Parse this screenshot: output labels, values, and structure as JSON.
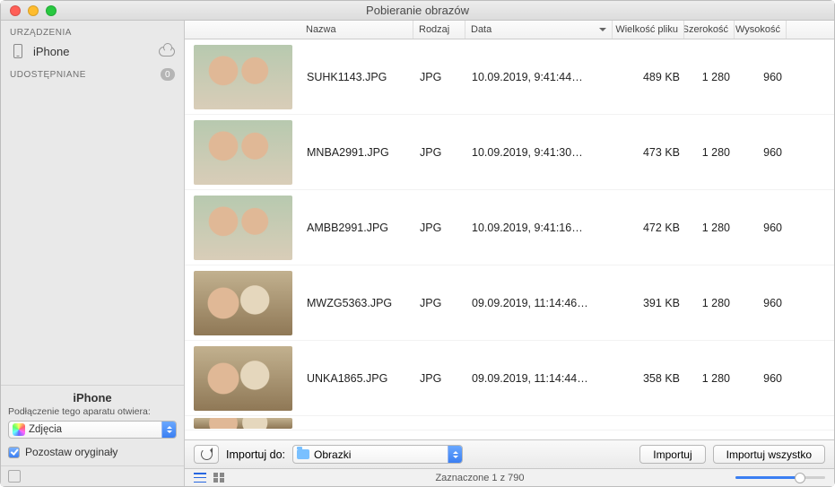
{
  "window": {
    "title": "Pobieranie obrazów"
  },
  "sidebar": {
    "devices_header": "URZĄDZENIA",
    "device_name": "iPhone",
    "shared_header": "UDOSTĘPNIANE",
    "shared_count": "0",
    "bottom_device": "iPhone",
    "bottom_hint": "Podłączenie tego aparatu otwiera:",
    "app_popup": "Zdjęcia",
    "keep_originals": "Pozostaw oryginały"
  },
  "columns": {
    "name": "Nazwa",
    "kind": "Rodzaj",
    "date": "Data",
    "size": "Wielkość pliku",
    "width": "Szerokość",
    "height": "Wysokość"
  },
  "rows": [
    {
      "name": "SUHK1143.JPG",
      "kind": "JPG",
      "date": "10.09.2019, 9:41:44…",
      "size": "489 KB",
      "w": "1 280",
      "h": "960"
    },
    {
      "name": "MNBA2991.JPG",
      "kind": "JPG",
      "date": "10.09.2019, 9:41:30…",
      "size": "473 KB",
      "w": "1 280",
      "h": "960"
    },
    {
      "name": "AMBB2991.JPG",
      "kind": "JPG",
      "date": "10.09.2019, 9:41:16…",
      "size": "472 KB",
      "w": "1 280",
      "h": "960"
    },
    {
      "name": "MWZG5363.JPG",
      "kind": "JPG",
      "date": "09.09.2019, 11:14:46…",
      "size": "391 KB",
      "w": "1 280",
      "h": "960"
    },
    {
      "name": "UNKA1865.JPG",
      "kind": "JPG",
      "date": "09.09.2019, 11:14:44…",
      "size": "358 KB",
      "w": "1 280",
      "h": "960"
    }
  ],
  "toolbar": {
    "import_to_label": "Importuj do:",
    "destination": "Obrazki",
    "import": "Importuj",
    "import_all": "Importuj wszystko"
  },
  "status": {
    "selection": "Zaznaczone 1 z 790"
  }
}
